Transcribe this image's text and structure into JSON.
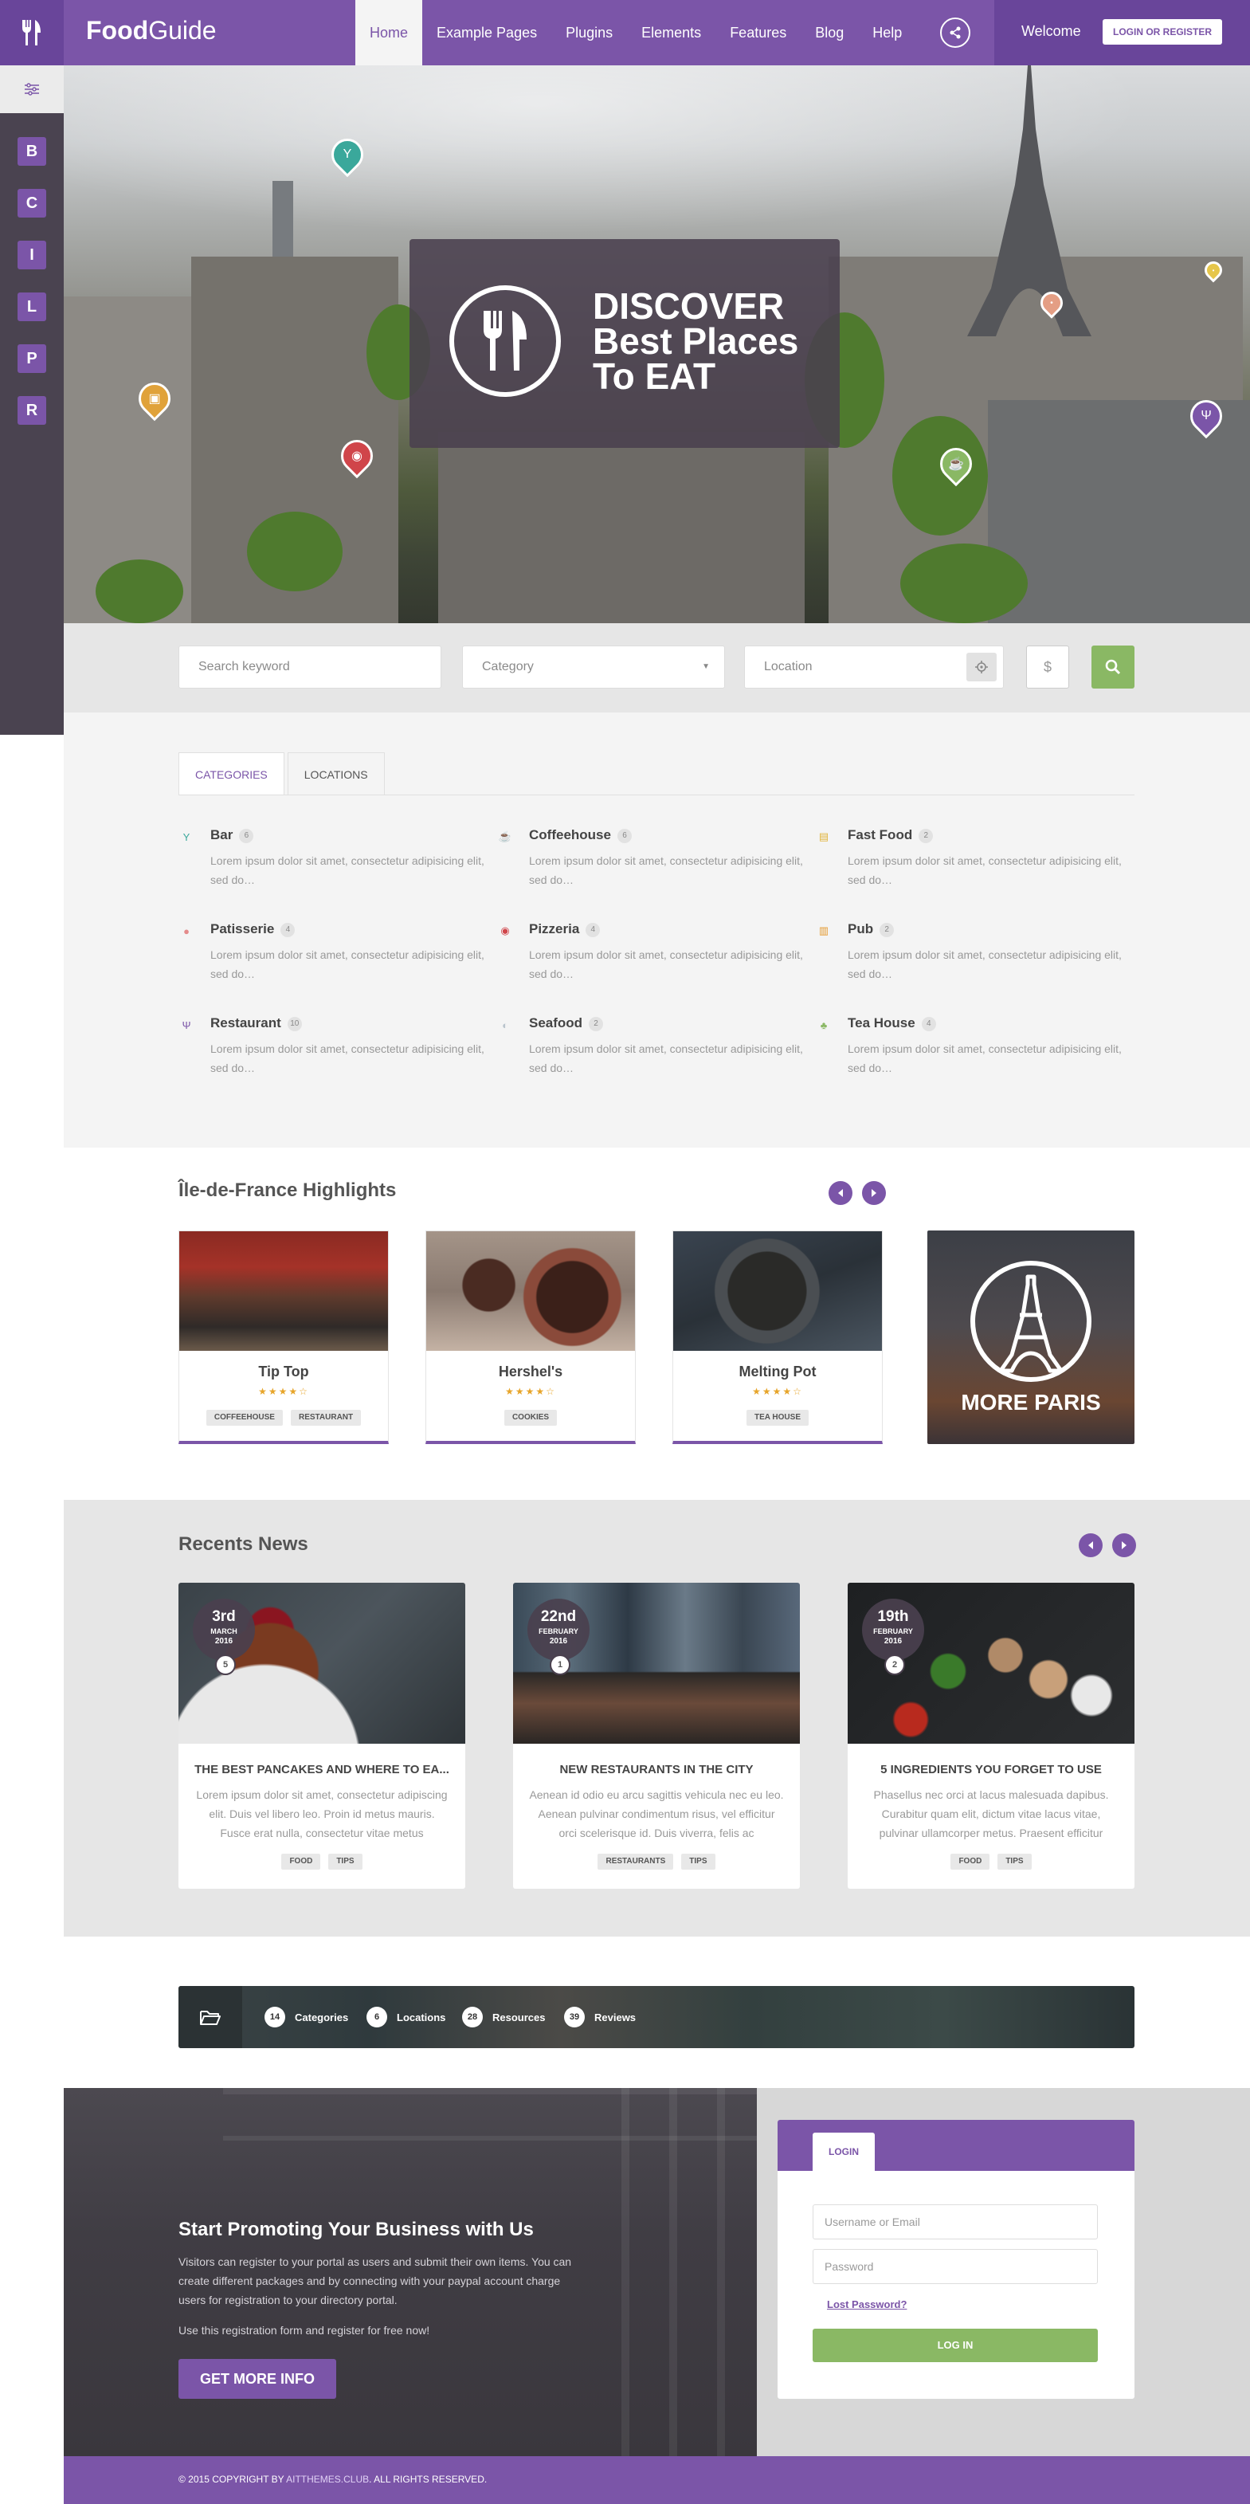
{
  "header": {
    "brand_bold": "Food",
    "brand_light": "Guide",
    "nav": [
      "Home",
      "Example Pages",
      "Plugins",
      "Elements",
      "Features",
      "Blog",
      "Help"
    ],
    "welcome": "Welcome",
    "login_button": "LOGIN OR REGISTER",
    "accent_color": "#7b55a8"
  },
  "sidebar": {
    "letters": [
      "B",
      "C",
      "I",
      "L",
      "P",
      "R"
    ],
    "filter_icon": "sliders-icon"
  },
  "hero": {
    "line1": "DISCOVER",
    "line2": "Best Places",
    "line3": "To EAT"
  },
  "search": {
    "keyword_placeholder": "Search keyword",
    "category_placeholder": "Category",
    "location_placeholder": "Location"
  },
  "categories": {
    "tabs": [
      "CATEGORIES",
      "LOCATIONS"
    ],
    "items": [
      {
        "name": "Bar",
        "count": "6",
        "desc": "Lorem ipsum dolor sit amet, consectetur adipisicing elit, sed do…",
        "icon_color": "#3aa89b"
      },
      {
        "name": "Coffeehouse",
        "count": "6",
        "desc": "Lorem ipsum dolor sit amet, consectetur adipisicing elit, sed do…",
        "icon_color": "#c8a06a"
      },
      {
        "name": "Fast Food",
        "count": "2",
        "desc": "Lorem ipsum dolor sit amet, consectetur adipisicing elit, sed do…",
        "icon_color": "#e0b43a"
      },
      {
        "name": "Patisserie",
        "count": "4",
        "desc": "Lorem ipsum dolor sit amet, consectetur adipisicing elit, sed do…",
        "icon_color": "#e48a8a"
      },
      {
        "name": "Pizzeria",
        "count": "4",
        "desc": "Lorem ipsum dolor sit amet, consectetur adipisicing elit, sed do…",
        "icon_color": "#d0454a"
      },
      {
        "name": "Pub",
        "count": "2",
        "desc": "Lorem ipsum dolor sit amet, consectetur adipisicing elit, sed do…",
        "icon_color": "#e59a2f"
      },
      {
        "name": "Restaurant",
        "count": "10",
        "desc": "Lorem ipsum dolor sit amet, consectetur adipisicing elit, sed do…",
        "icon_color": "#7b55a8"
      },
      {
        "name": "Seafood",
        "count": "2",
        "desc": "Lorem ipsum dolor sit amet, consectetur adipisicing elit, sed do…",
        "icon_color": "#cfd8e0"
      },
      {
        "name": "Tea House",
        "count": "4",
        "desc": "Lorem ipsum dolor sit amet, consectetur adipisicing elit, sed do…",
        "icon_color": "#8ab864"
      }
    ]
  },
  "highlights": {
    "title": "Île-de-France Highlights",
    "cards": [
      {
        "name": "Tip Top",
        "stars": "★★★★☆",
        "tags": [
          "COFFEEHOUSE",
          "RESTAURANT"
        ]
      },
      {
        "name": "Hershel's",
        "stars": "★★★★☆",
        "tags": [
          "COOKIES"
        ]
      },
      {
        "name": "Melting Pot",
        "stars": "★★★★☆",
        "tags": [
          "TEA HOUSE"
        ]
      }
    ],
    "more": "MORE PARIS"
  },
  "news": {
    "title": "Recents News",
    "items": [
      {
        "day": "3rd",
        "month": "MARCH",
        "year": "2016",
        "comments": "5",
        "title": "THE BEST PANCAKES AND WHERE TO EA...",
        "body": "Lorem ipsum dolor sit amet, consectetur adipiscing elit. Duis vel libero leo. Proin id metus mauris. Fusce erat nulla, consectetur vitae metus",
        "tags": [
          "FOOD",
          "TIPS"
        ]
      },
      {
        "day": "22nd",
        "month": "FEBRUARY",
        "year": "2016",
        "comments": "1",
        "title": "NEW RESTAURANTS IN THE CITY",
        "body": "Aenean id odio eu arcu sagittis vehicula nec eu leo. Aenean pulvinar condimentum risus, vel efficitur orci scelerisque id. Duis viverra, felis ac",
        "tags": [
          "RESTAURANTS",
          "TIPS"
        ]
      },
      {
        "day": "19th",
        "month": "FEBRUARY",
        "year": "2016",
        "comments": "2",
        "title": "5 INGREDIENTS YOU FORGET TO USE",
        "body": "Phasellus nec orci at lacus malesuada dapibus. Curabitur quam elit, dictum vitae lacus vitae, pulvinar ullamcorper metus. Praesent efficitur",
        "tags": [
          "FOOD",
          "TIPS"
        ]
      }
    ]
  },
  "stats": [
    {
      "num": "14",
      "label": "Categories"
    },
    {
      "num": "6",
      "label": "Locations"
    },
    {
      "num": "28",
      "label": "Resources"
    },
    {
      "num": "39",
      "label": "Reviews"
    }
  ],
  "promo": {
    "title": "Start Promoting Your Business with Us",
    "text": "Visitors can register to your portal as users and submit their own items. You can create different packages and by connecting with your paypal account charge users for registration to your directory portal.",
    "text2": "Use this registration form and register for free now!",
    "button": "GET MORE INFO"
  },
  "login": {
    "tab": "LOGIN",
    "username_placeholder": "Username or Email",
    "password_placeholder": "Password",
    "lost_password": "Lost Password?",
    "submit": "LOG IN"
  },
  "footer": {
    "prefix": "© 2015 COPYRIGHT BY ",
    "link": "AITTHEMES.CLUB",
    "suffix": ". ALL RIGHTS RESERVED."
  }
}
